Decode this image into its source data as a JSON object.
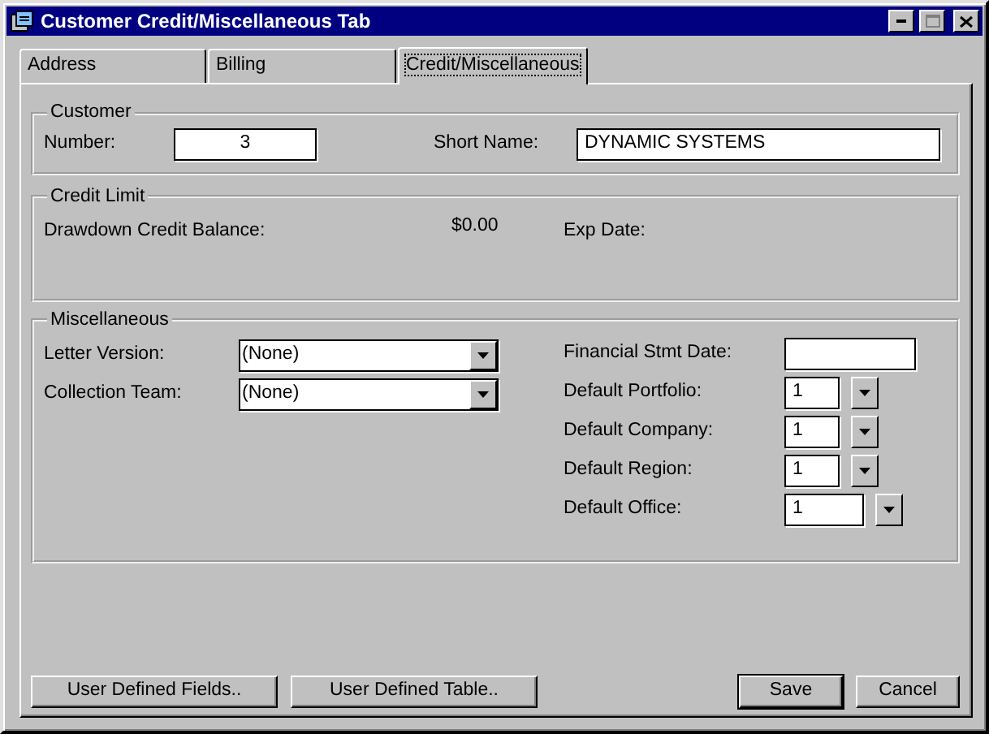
{
  "window": {
    "title": "Customer Credit/Miscellaneous Tab"
  },
  "tabs": [
    {
      "label": "Address",
      "selected": false
    },
    {
      "label": "Billing",
      "selected": false
    },
    {
      "label": "Credit/Miscellaneous",
      "selected": true
    }
  ],
  "customer": {
    "title": "Customer",
    "number": {
      "label": "Number:",
      "value": "3"
    },
    "short_name": {
      "label": "Short Name:",
      "value": "DYNAMIC SYSTEMS"
    }
  },
  "credit_limit": {
    "title": "Credit Limit",
    "drawdown": {
      "label": "Drawdown Credit Balance:",
      "value": "$0.00"
    },
    "exp_date": {
      "label": "Exp Date:"
    }
  },
  "miscellaneous": {
    "title": "Miscellaneous",
    "left": [
      {
        "label": "Letter Version:",
        "value": "(None)",
        "kind": "combo"
      },
      {
        "label": "Collection Team:",
        "value": "(None)",
        "kind": "combo"
      }
    ],
    "right": [
      {
        "label": "Financial Stmt Date:",
        "kind": "text"
      },
      {
        "label": "Default Portfolio:",
        "value": "1",
        "kind": "picker"
      },
      {
        "label": "Default Company:",
        "value": "1",
        "kind": "picker"
      },
      {
        "label": "Default Region:",
        "value": "1",
        "kind": "picker"
      },
      {
        "label": "Default Office:",
        "value": "1",
        "kind": "picker"
      }
    ]
  },
  "left_buttons": [
    {
      "label": "User Defined Fields..",
      "default": false
    },
    {
      "label": "User Defined Table..",
      "default": false
    }
  ],
  "right_buttons": [
    {
      "label": "Save",
      "default": true
    },
    {
      "label": "Cancel",
      "default": false
    }
  ]
}
